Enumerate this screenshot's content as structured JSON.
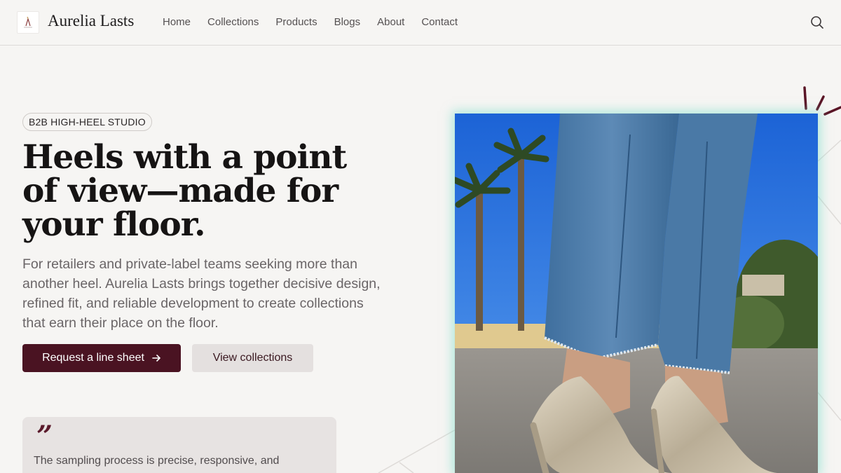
{
  "header": {
    "brand": "Aurelia Lasts",
    "nav": [
      "Home",
      "Collections",
      "Products",
      "Blogs",
      "About",
      "Contact"
    ]
  },
  "hero": {
    "badge": "B2B HIGH-HEEL STUDIO",
    "headline": "Heels with a point of view—made for your floor.",
    "lede": "For retailers and private-label teams seeking more than another heel. Aurelia Lasts brings together decisive design, refined fit, and reliable development to create collections that earn their place on the floor.",
    "primary_cta": "Request a line sheet",
    "secondary_cta": "View collections"
  },
  "quote": {
    "mark": "”",
    "text": "The sampling process is precise, responsive, and"
  },
  "icons": {
    "search": "search-icon",
    "arrow": "arrow-right-icon"
  },
  "colors": {
    "accent": "#4a1322",
    "background": "#f6f5f3",
    "secondary_button": "#e4e0df",
    "photo_glow": "#78dcc8"
  }
}
